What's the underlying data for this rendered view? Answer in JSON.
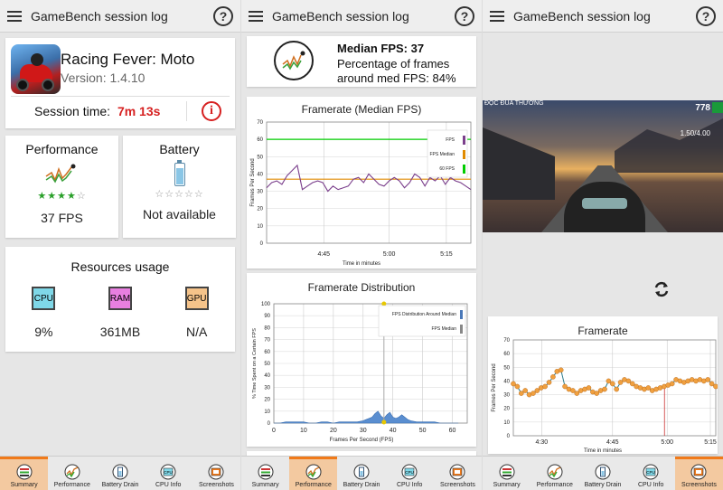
{
  "app_title": "GameBench session log",
  "help_label": "?",
  "summary": {
    "game_name": "Racing Fever: Moto",
    "version": "Version: 1.4.10",
    "session_time_label": "Session time:",
    "session_time_value": "7m 13s",
    "performance": {
      "title": "Performance",
      "value": "37 FPS",
      "stars_filled": 4,
      "stars_total": 5
    },
    "battery": {
      "title": "Battery",
      "value": "Not available",
      "stars_filled": 0,
      "stars_total": 5
    },
    "resources": {
      "title": "Resources usage",
      "items": [
        {
          "chip": "CPU",
          "value": "9%",
          "color": "#7fd8e8"
        },
        {
          "chip": "RAM",
          "value": "361MB",
          "color": "#e87fe0"
        },
        {
          "chip": "GPU",
          "value": "N/A",
          "color": "#f5c38a"
        }
      ]
    }
  },
  "performance_tab": {
    "median_fps": "Median FPS: 37",
    "percentage_line1": "Percentage of frames",
    "percentage_line2": "around med FPS: 84%"
  },
  "nav": {
    "items": [
      "Summary",
      "Performance",
      "Battery Drain",
      "CPU Info",
      "Screenshots"
    ],
    "cpu_icon_text": "CPU"
  },
  "screenshot": {
    "top_left": "ĐỘC ĐUA THƯỜNG",
    "score": "778",
    "speed": "1.50/4.00"
  },
  "chart_data": [
    {
      "type": "line",
      "title": "Framerate (Median FPS)",
      "xlabel": "Time in minutes",
      "ylabel": "Frames Per Second",
      "ylim": [
        0,
        70
      ],
      "yticks": [
        0,
        10,
        20,
        30,
        40,
        50,
        60,
        70
      ],
      "xticks": [
        "4:45",
        "5:00",
        "5:15"
      ],
      "legend": [
        "FPS",
        "FPS Median",
        "60 FPS"
      ],
      "legend_colors": [
        "#7b3f8c",
        "#e08a00",
        "#00cc00"
      ],
      "median": 37,
      "reference": 60,
      "x": [
        0,
        1,
        2,
        3,
        4,
        5,
        6,
        7,
        8,
        9,
        10,
        11,
        12,
        13,
        14,
        15,
        16,
        17,
        18,
        19,
        20,
        21,
        22,
        23,
        24,
        25,
        26,
        27,
        28,
        29,
        30,
        31,
        32,
        33,
        34,
        35,
        36,
        37,
        38,
        39,
        40
      ],
      "series": [
        {
          "values": [
            32,
            35,
            36,
            34,
            39,
            42,
            45,
            31,
            33,
            35,
            36,
            35,
            30,
            33,
            31,
            32,
            33,
            37,
            38,
            35,
            40,
            37,
            34,
            33,
            36,
            38,
            36,
            32,
            35,
            40,
            38,
            33,
            38,
            36,
            39,
            34,
            38,
            36,
            35,
            33,
            31
          ]
        }
      ]
    },
    {
      "type": "area",
      "title": "Framerate Distribution",
      "xlabel": "Frames Per Second (FPS)",
      "ylabel": "% Time Spent on a Certain FPS",
      "xlim": [
        0,
        65
      ],
      "ylim": [
        0,
        100
      ],
      "xticks": [
        0,
        10,
        20,
        30,
        40,
        50,
        60
      ],
      "yticks": [
        0,
        10,
        20,
        30,
        40,
        50,
        60,
        70,
        80,
        90,
        100
      ],
      "legend": [
        "FPS Distribution Around Median",
        "FPS Median"
      ],
      "median": 37,
      "x": [
        0,
        2,
        4,
        6,
        8,
        10,
        12,
        14,
        16,
        18,
        20,
        22,
        24,
        26,
        28,
        30,
        31,
        32,
        33,
        34,
        35,
        36,
        37,
        38,
        39,
        40,
        41,
        42,
        43,
        44,
        45,
        46,
        48,
        50,
        52,
        54,
        56,
        58,
        60,
        62
      ],
      "series": [
        {
          "values": [
            0,
            0,
            1,
            1,
            1,
            1,
            0,
            0,
            1,
            1,
            0,
            1,
            1,
            1,
            1,
            2,
            3,
            4,
            5,
            8,
            10,
            6,
            4,
            7,
            9,
            5,
            4,
            5,
            7,
            5,
            3,
            2,
            1,
            1,
            1,
            1,
            0,
            0,
            0,
            0
          ]
        }
      ]
    },
    {
      "type": "scatter",
      "title": "Framerate",
      "xlabel": "Time in minutes",
      "ylabel": "Frames Per Second",
      "ylim": [
        0,
        70
      ],
      "yticks": [
        0,
        10,
        20,
        30,
        40,
        50,
        60,
        70
      ],
      "xticks": [
        "4:30",
        "4:45",
        "5:00",
        "5:15"
      ],
      "marker": 5.0,
      "x": [
        0,
        1,
        2,
        3,
        4,
        5,
        6,
        7,
        8,
        9,
        10,
        11,
        12,
        13,
        14,
        15,
        16,
        17,
        18,
        19,
        20,
        21,
        22,
        23,
        24,
        25,
        26,
        27,
        28,
        29,
        30,
        31,
        32,
        33,
        34,
        35,
        36,
        37,
        38,
        39,
        40,
        41,
        42,
        43,
        44,
        45,
        46,
        47,
        48,
        49,
        50,
        51
      ],
      "series": [
        {
          "values": [
            38,
            36,
            31,
            33,
            30,
            31,
            33,
            35,
            36,
            39,
            43,
            47,
            48,
            36,
            34,
            33,
            31,
            33,
            34,
            35,
            32,
            31,
            33,
            34,
            40,
            38,
            34,
            39,
            41,
            40,
            38,
            36,
            35,
            34,
            35,
            33,
            34,
            35,
            36,
            37,
            38,
            41,
            40,
            39,
            40,
            41,
            40,
            41,
            40,
            41,
            38,
            36
          ]
        }
      ]
    }
  ]
}
